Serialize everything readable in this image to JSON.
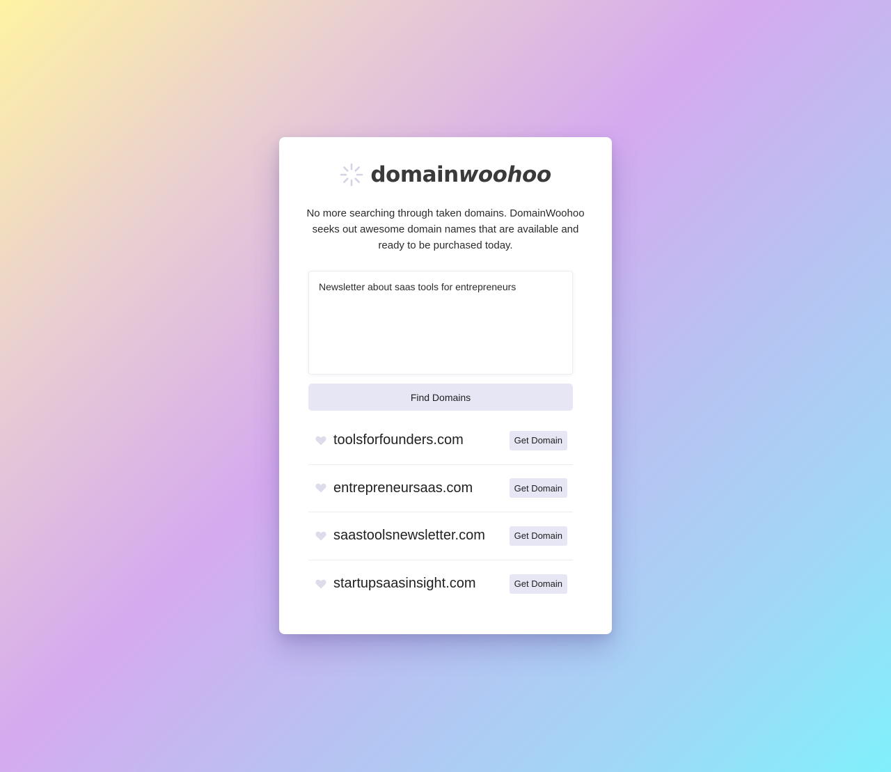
{
  "logo": {
    "text_regular": "domain",
    "text_italic": "woohoo",
    "icon": "spinner-icon"
  },
  "tagline": "No more searching through taken domains. DomainWoohoo seeks out awesome domain names that are available and ready to be purchased today.",
  "search": {
    "value": "Newsletter about saas tools for entrepreneurs",
    "placeholder": ""
  },
  "find_button_label": "Find Domains",
  "results": [
    {
      "domain": "toolsforfounders.com",
      "button_label": "Get Domain",
      "icon": "heart-icon"
    },
    {
      "domain": "entrepreneursaas.com",
      "button_label": "Get Domain",
      "icon": "heart-icon"
    },
    {
      "domain": "saastoolsnewsletter.com",
      "button_label": "Get Domain",
      "icon": "heart-icon"
    },
    {
      "domain": "startupsaasinsight.com",
      "button_label": "Get Domain",
      "icon": "heart-icon"
    }
  ],
  "colors": {
    "button_bg": "#e6e6f4",
    "heart": "#dcdcea",
    "logo_text": "#3a3a3a"
  }
}
